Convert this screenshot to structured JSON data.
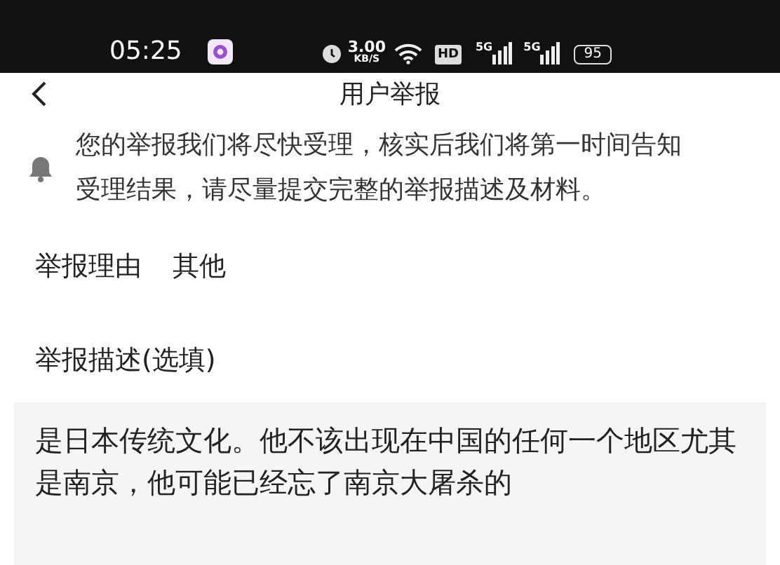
{
  "status_bar": {
    "time": "05:25",
    "net_speed": "3.00",
    "net_unit": "KB/S",
    "hd": "HD",
    "sim1": "5G",
    "sim2": "5G",
    "battery": "95"
  },
  "header": {
    "title": "用户举报"
  },
  "notice": "您的举报我们将尽快受理，核实后我们将第一时间告知受理结果，请尽量提交完整的举报描述及材料。",
  "reason": {
    "label": "举报理由",
    "value": "其他"
  },
  "description": {
    "label": "举报描述(选填)",
    "value": "是日本传统文化。他不该出现在中国的任何一个地区尤其是南京，他可能已经忘了南京大屠杀的"
  }
}
